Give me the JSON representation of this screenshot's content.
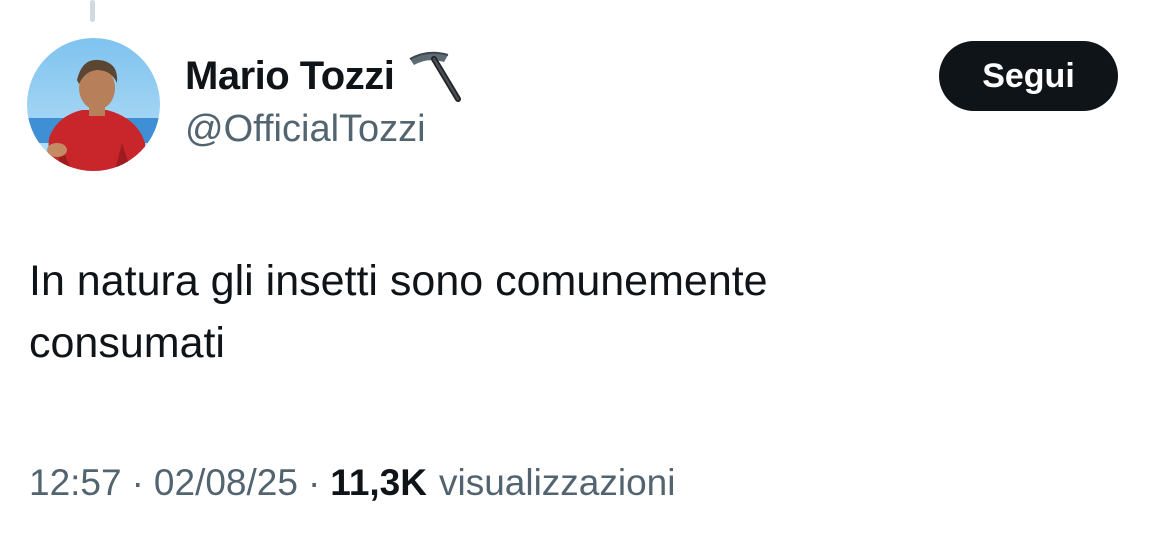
{
  "author": {
    "display_name": "Mario Tozzi",
    "badge_icon": "pickaxe-icon",
    "handle": "@OfficialTozzi"
  },
  "follow_button": {
    "label": "Segui"
  },
  "tweet": {
    "text": "In natura gli insetti sono comunemente\nconsumati"
  },
  "meta": {
    "time": "12:57",
    "separator": "·",
    "date": "02/08/25",
    "views_count": "11,3K",
    "views_label": "visualizzazioni"
  },
  "colors": {
    "primary_text": "#0f1419",
    "secondary_text": "#536471",
    "button_bg": "#0f1419",
    "button_text": "#ffffff",
    "thread_line": "#cfd9de"
  }
}
